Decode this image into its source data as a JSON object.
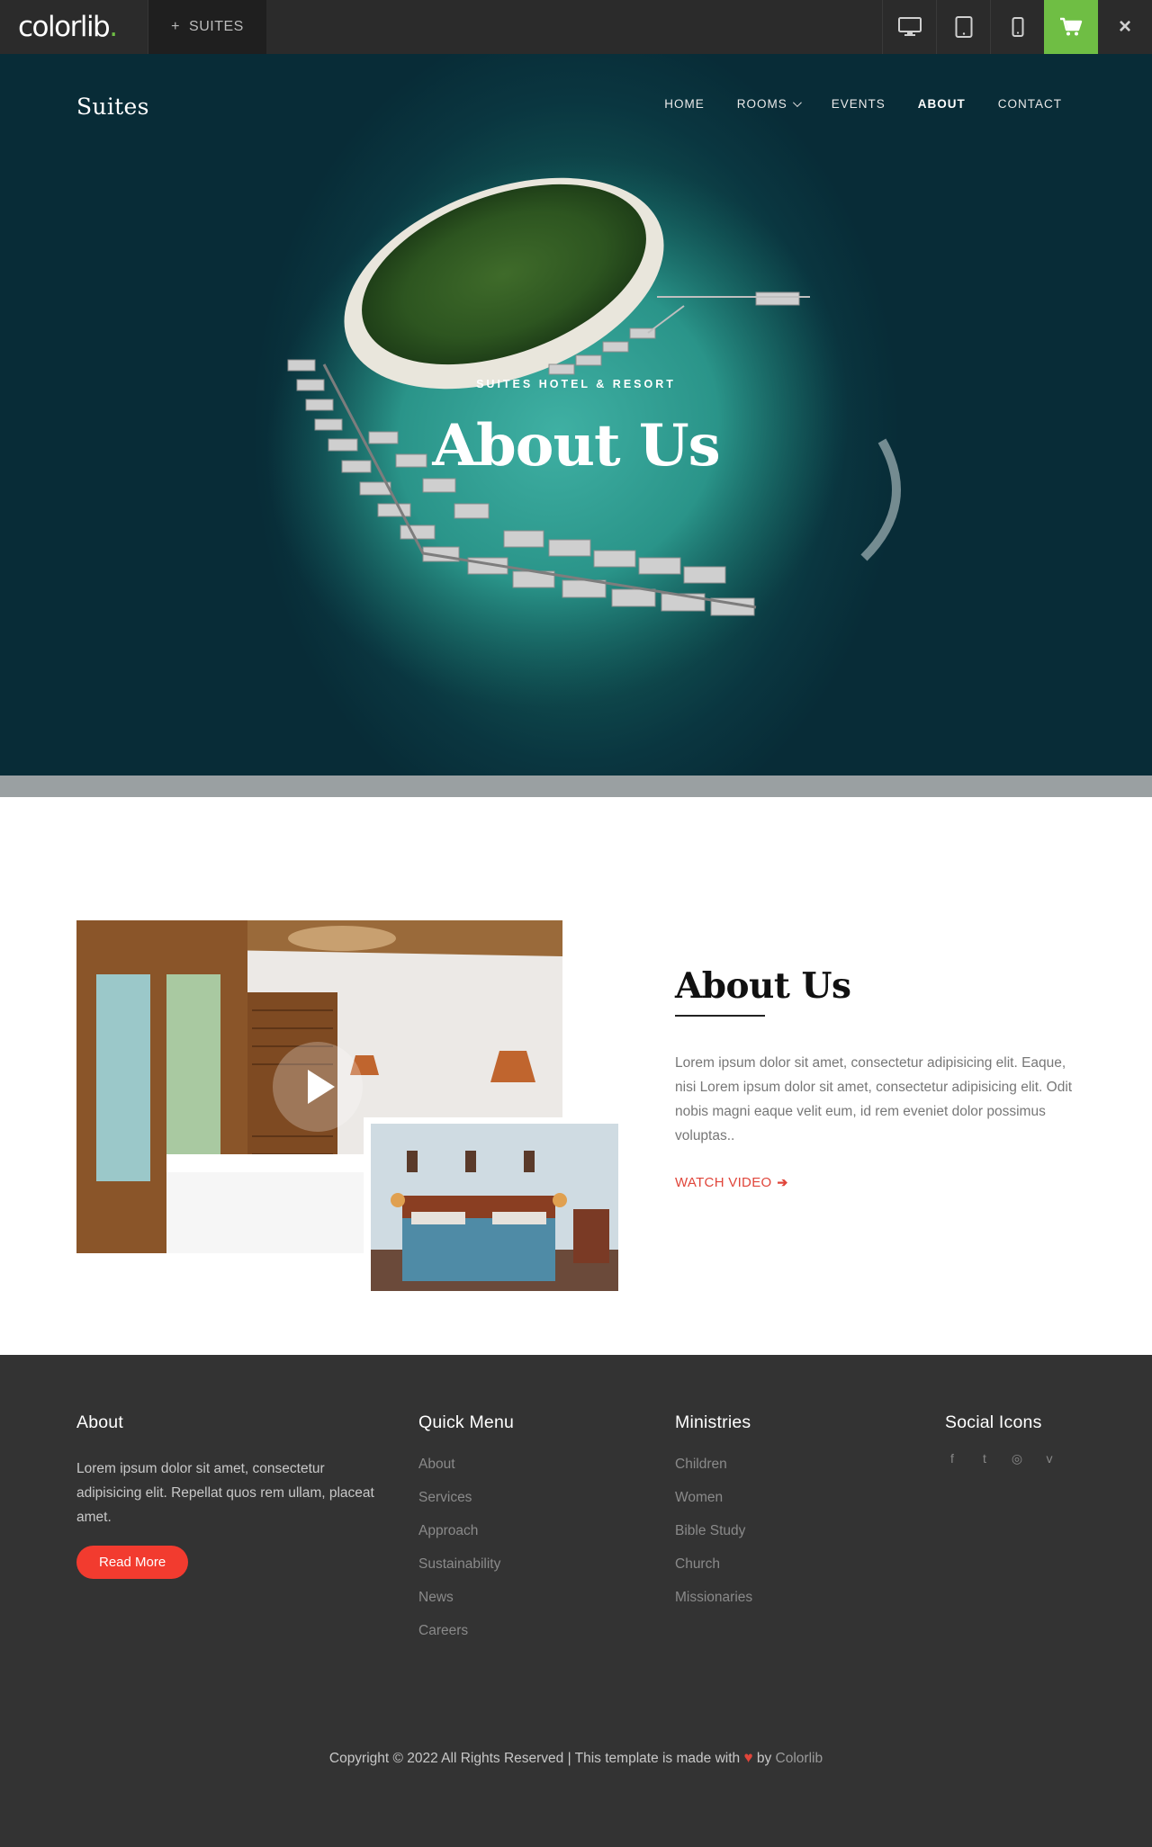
{
  "topbar": {
    "brand": "colorlib",
    "brand_dot": ".",
    "theme_tab": "SUITES",
    "theme_tab_icon": "+",
    "devices": [
      "desktop-icon",
      "tablet-icon",
      "mobile-icon"
    ],
    "cart_icon": "cart-icon",
    "close_icon": "×",
    "colors": {
      "bar": "#2b2b2b",
      "cart": "#6fbe44"
    }
  },
  "site": {
    "logo": "Suites",
    "nav": [
      {
        "label": "HOME",
        "active": false
      },
      {
        "label": "ROOMS",
        "active": false,
        "dropdown": true
      },
      {
        "label": "EVENTS",
        "active": false
      },
      {
        "label": "ABOUT",
        "active": true
      },
      {
        "label": "CONTACT",
        "active": false
      }
    ]
  },
  "hero": {
    "subtitle": "SUITES HOTEL & RESORT",
    "title": "About Us"
  },
  "about": {
    "title": "About Us",
    "text": "Lorem ipsum dolor sit amet, consectetur adipisicing elit. Eaque, nisi Lorem ipsum dolor sit amet, consectetur adipisicing elit. Odit nobis magni eaque velit eum, id rem eveniet dolor possimus voluptas..",
    "watch_label": "WATCH VIDEO",
    "watch_arrow": "➔",
    "accent": "#e0453a"
  },
  "footer": {
    "about": {
      "heading": "About",
      "text": "Lorem ipsum dolor sit amet, consectetur adipisicing elit. Repellat quos rem ullam, placeat amet.",
      "button": "Read More"
    },
    "quick_menu": {
      "heading": "Quick Menu",
      "items": [
        "About",
        "Services",
        "Approach",
        "Sustainability",
        "News",
        "Careers"
      ]
    },
    "ministries": {
      "heading": "Ministries",
      "items": [
        "Children",
        "Women",
        "Bible Study",
        "Church",
        "Missionaries"
      ]
    },
    "social": {
      "heading": "Social Icons",
      "icons": [
        {
          "name": "facebook-icon",
          "glyph": "f"
        },
        {
          "name": "twitter-icon",
          "glyph": "t"
        },
        {
          "name": "instagram-icon",
          "glyph": "◎"
        },
        {
          "name": "vimeo-icon",
          "glyph": "v"
        }
      ]
    },
    "copyright_prefix": "Copyright © 2022 All Rights Reserved | This template is made with",
    "copyright_heart": "♥",
    "copyright_by": "by",
    "copyright_link": "Colorlib"
  }
}
